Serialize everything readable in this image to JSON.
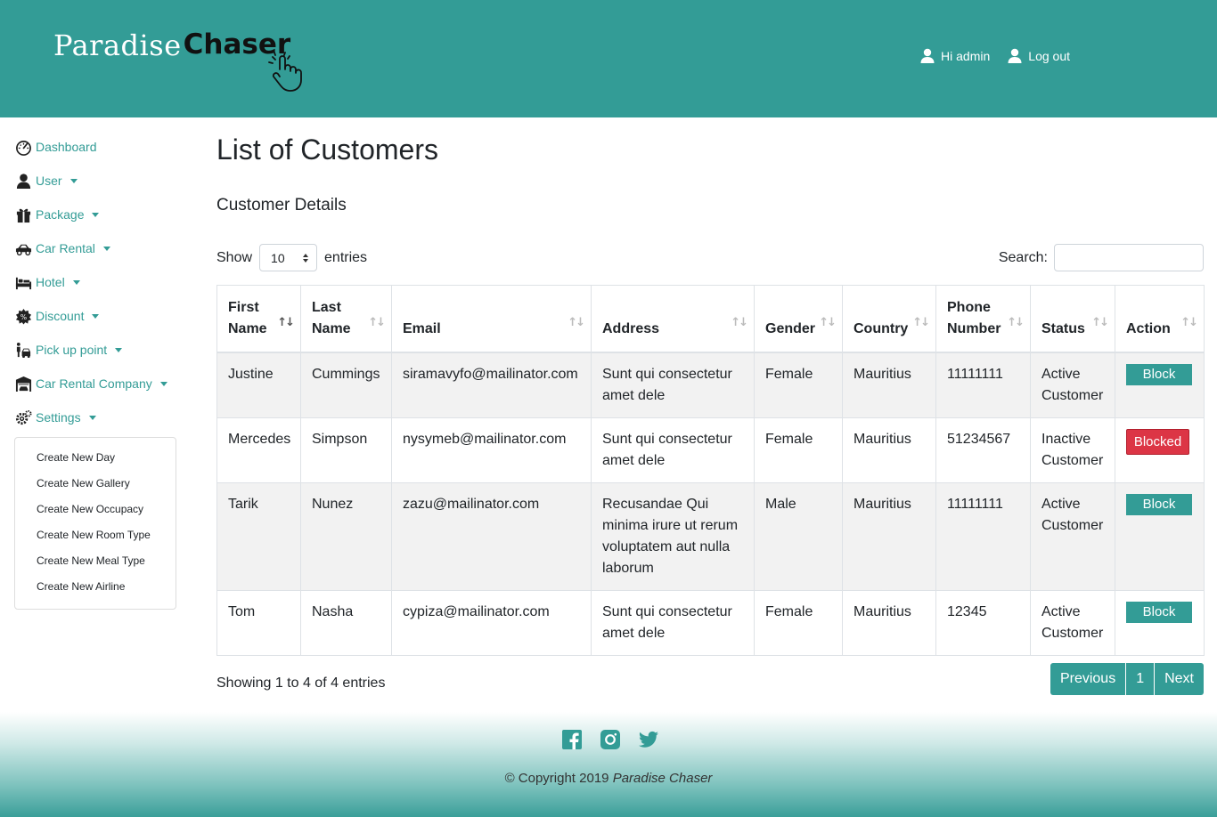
{
  "brand": {
    "light": "Paradise",
    "bold": "Chaser"
  },
  "header_nav": {
    "greeting": "Hi admin",
    "logout": "Log out"
  },
  "sidebar": {
    "items": [
      {
        "label": "Dashboard",
        "icon": "dashboard-icon",
        "caret": false
      },
      {
        "label": "User",
        "icon": "user-icon",
        "caret": true
      },
      {
        "label": "Package",
        "icon": "gift-icon",
        "caret": true
      },
      {
        "label": "Car Rental",
        "icon": "car-icon",
        "caret": true
      },
      {
        "label": "Hotel",
        "icon": "bed-icon",
        "caret": true
      },
      {
        "label": "Discount",
        "icon": "discount-badge-icon",
        "caret": true
      },
      {
        "label": "Pick up point",
        "icon": "pickup-icon",
        "caret": true
      },
      {
        "label": "Car Rental Company",
        "icon": "garage-icon",
        "caret": true
      },
      {
        "label": "Settings",
        "icon": "gears-icon",
        "caret": true
      }
    ],
    "settings_submenu": [
      "Create New Day",
      "Create New Gallery",
      "Create New Occupacy",
      "Create New Room Type",
      "Create New Meal Type",
      "Create New Airline"
    ]
  },
  "main": {
    "title": "List of Customers",
    "section": "Customer Details",
    "show_label": "Show",
    "entries_label": "entries",
    "page_length": "10",
    "search_label": "Search:",
    "search_value": ""
  },
  "table": {
    "headers": [
      "First Name",
      "Last Name",
      "Email",
      "Address",
      "Gender",
      "Country",
      "Phone Number",
      "Status",
      "Action"
    ],
    "rows": [
      {
        "first": "Justine",
        "last": "Cummings",
        "email": "siramavyfo@mailinator.com",
        "address": "Sunt qui consectetur amet dele",
        "gender": "Female",
        "country": "Mauritius",
        "phone": "11111111",
        "status": "Active Customer",
        "action": "Block"
      },
      {
        "first": "Mercedes",
        "last": "Simpson",
        "email": "nysymeb@mailinator.com",
        "address": "Sunt qui consectetur amet dele",
        "gender": "Female",
        "country": "Mauritius",
        "phone": "51234567",
        "status": "Inactive Customer",
        "action": "Blocked"
      },
      {
        "first": "Tarik",
        "last": "Nunez",
        "email": "zazu@mailinator.com",
        "address": "Recusandae Qui minima irure ut rerum voluptatem aut nulla laborum",
        "gender": "Male",
        "country": "Mauritius",
        "phone": "11111111",
        "status": "Active Customer",
        "action": "Block"
      },
      {
        "first": "Tom",
        "last": "Nasha",
        "email": "cypiza@mailinator.com",
        "address": "Sunt qui consectetur amet dele",
        "gender": "Female",
        "country": "Mauritius",
        "phone": "12345",
        "status": "Active Customer",
        "action": "Block"
      }
    ]
  },
  "pagination": {
    "info": "Showing 1 to 4 of 4 entries",
    "previous": "Previous",
    "current": "1",
    "next": "Next"
  },
  "footer": {
    "copyright_prefix": "© Copyright 2019 ",
    "copyright_name": "Paradise Chaser",
    "social_icons": [
      "facebook-icon",
      "instagram-icon",
      "twitter-icon"
    ]
  },
  "colors": {
    "primary": "#339c96",
    "danger": "#dc3545"
  }
}
